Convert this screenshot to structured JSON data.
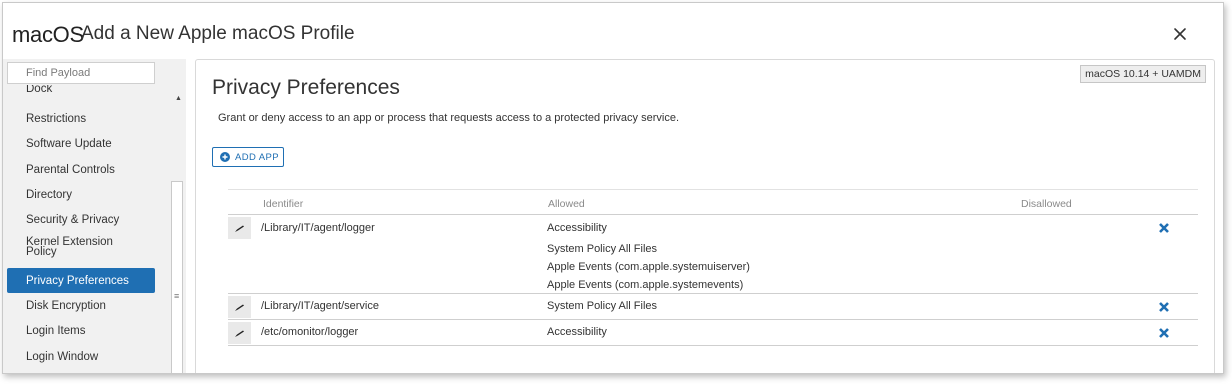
{
  "header": {
    "brand": "macOS",
    "title": "Add a New Apple macOS Profile"
  },
  "sidebar": {
    "search_placeholder": "Find Payload",
    "items": [
      {
        "label": "Dock",
        "active": false
      },
      {
        "label": "Restrictions",
        "active": false
      },
      {
        "label": "Software Update",
        "active": false
      },
      {
        "label": "Parental Controls",
        "active": false
      },
      {
        "label": "Directory",
        "active": false
      },
      {
        "label": "Security & Privacy",
        "active": false
      },
      {
        "label": "Kernel Extension Policy",
        "active": false
      },
      {
        "label": "Privacy Preferences",
        "active": true
      },
      {
        "label": "Disk Encryption",
        "active": false
      },
      {
        "label": "Login Items",
        "active": false
      },
      {
        "label": "Login Window",
        "active": false
      }
    ]
  },
  "panel": {
    "os_badge": "macOS 10.14 + UAMDM",
    "title": "Privacy Preferences",
    "description": "Grant or deny access to an app or process that requests access to a protected privacy service.",
    "add_button": "ADD APP",
    "columns": {
      "identifier": "Identifier",
      "allowed": "Allowed",
      "disallowed": "Disallowed"
    },
    "rows": [
      {
        "identifier": "/Library/IT/agent/logger",
        "allowed": [
          "Accessibility",
          "System Policy All Files",
          "Apple Events (com.apple.systemuiserver)",
          "Apple Events (com.apple.systemevents)"
        ],
        "disallowed": ""
      },
      {
        "identifier": "/Library/IT/agent/service",
        "allowed": [
          "System Policy All Files"
        ],
        "disallowed": ""
      },
      {
        "identifier": "/etc/omonitor/logger",
        "allowed": [
          "Accessibility"
        ],
        "disallowed": ""
      }
    ]
  },
  "colors": {
    "accent": "#1f6fb3",
    "sidebar_bg": "#f1f1f1"
  },
  "icons": {
    "close": "close-icon",
    "add": "plus-circle-icon",
    "edit": "pencil-icon",
    "delete": "x-icon"
  }
}
